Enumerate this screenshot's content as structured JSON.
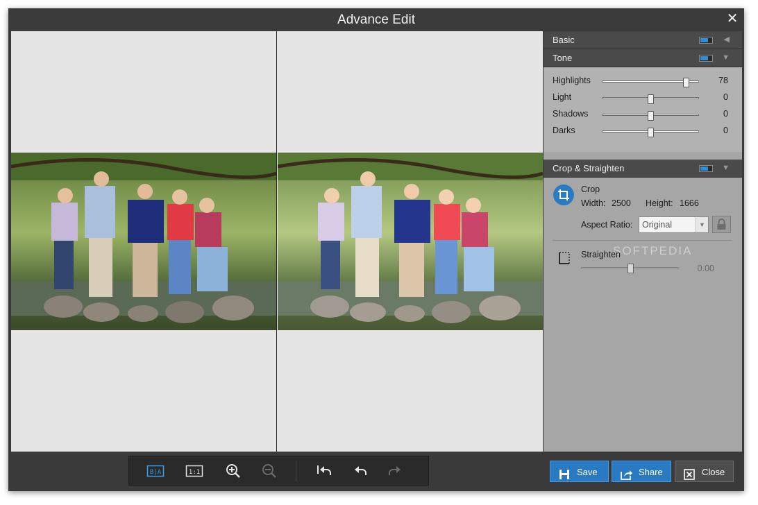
{
  "window": {
    "title": "Advance Edit",
    "close_glyph": "✕"
  },
  "panel": {
    "basic": {
      "label": "Basic",
      "enabled": true,
      "expanded": false
    },
    "tone": {
      "label": "Tone",
      "enabled": true,
      "expanded": true,
      "sliders": [
        {
          "label": "Highlights",
          "value": "78",
          "level": 0.87
        },
        {
          "label": "Light",
          "value": "0",
          "level": 0.5
        },
        {
          "label": "Shadows",
          "value": "0",
          "level": 0.5
        },
        {
          "label": "Darks",
          "value": "0",
          "level": 0.5
        }
      ]
    },
    "crop": {
      "header_label": "Crop & Straighten",
      "enabled": true,
      "expanded": true,
      "title": "Crop",
      "width_label": "Width:",
      "width_value": "2500",
      "height_label": "Height:",
      "height_value": "1666",
      "aspect_label": "Aspect Ratio:",
      "aspect_value": "Original",
      "straighten_label": "Straighten",
      "straighten_value": "0.00",
      "straighten_level": 0.5
    },
    "watermark": "SOFTPEDIA"
  },
  "toolbar": {
    "icons": [
      "before-after-icon",
      "actual-size-icon",
      "zoom-in-icon",
      "zoom-out-icon",
      "undo-all-icon",
      "undo-icon",
      "redo-icon"
    ]
  },
  "buttons": {
    "save": "Save",
    "share": "Share",
    "close": "Close"
  },
  "colors": {
    "accent": "#2a79c3",
    "titlebar": "#3b3b3b",
    "panel": "#a6a6a6",
    "canvas": "#e5e5e5"
  }
}
